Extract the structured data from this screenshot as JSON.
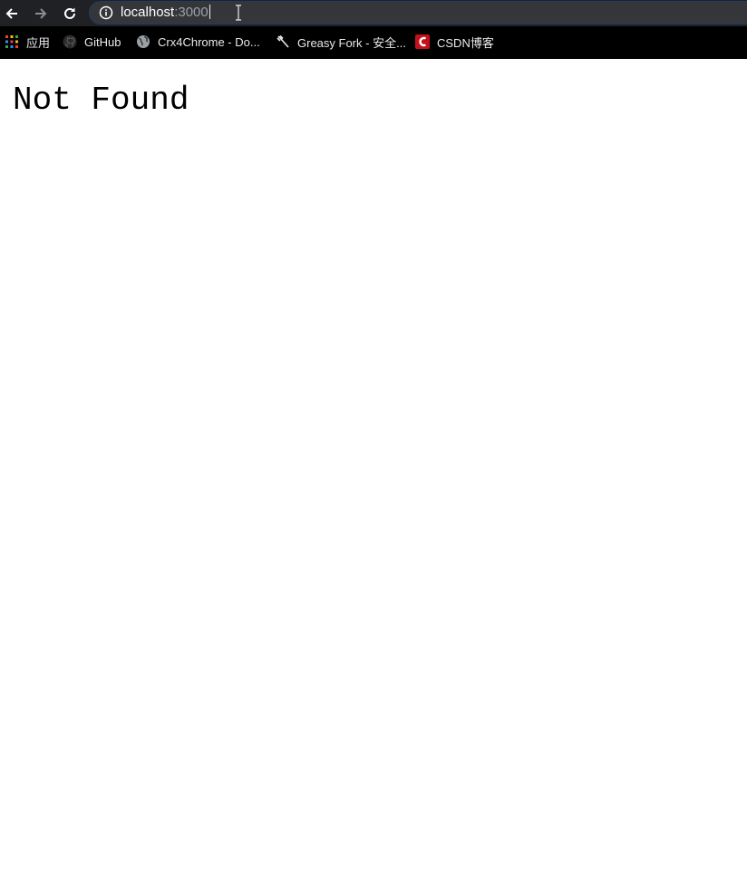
{
  "browser": {
    "url": {
      "host": "localhost",
      "port": ":3000"
    }
  },
  "bookmarks": [
    {
      "label": "应用",
      "icon": "apps-grid-icon"
    },
    {
      "label": "GitHub",
      "icon": "github-icon"
    },
    {
      "label": "Crx4Chrome - Do...",
      "icon": "globe-icon"
    },
    {
      "label": "Greasy Fork - 安全...",
      "icon": "greasy-fork-icon"
    },
    {
      "label": "CSDN博客",
      "icon": "csdn-icon"
    }
  ],
  "page": {
    "heading": "Not Found"
  },
  "colors": {
    "toolbar": "#202124",
    "bookmarks_bar": "#000000",
    "omnibox": "#35363a",
    "page": "#ffffff",
    "csdn_red": "#c3111a"
  }
}
